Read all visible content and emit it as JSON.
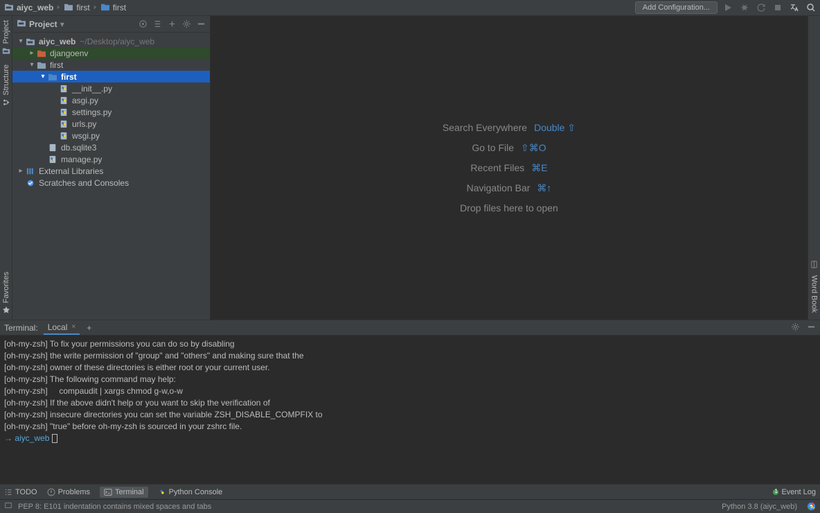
{
  "nav": {
    "crumbs": [
      "aiyc_web",
      "first",
      "first"
    ],
    "add_config": "Add Configuration..."
  },
  "leftstrip": {
    "project": "Project",
    "structure": "Structure",
    "favorites": "Favorites"
  },
  "rightstrip": {
    "wordbook": "Word Book"
  },
  "project_panel": {
    "title": "Project"
  },
  "tree": {
    "root_name": "aiyc_web",
    "root_path": "~/Desktop/aiyc_web",
    "djangoenv": "djangoenv",
    "first_outer": "first",
    "first_inner": "first",
    "init": "__init__.py",
    "asgi": "asgi.py",
    "settings": "settings.py",
    "urls": "urls.py",
    "wsgi": "wsgi.py",
    "db": "db.sqlite3",
    "manage": "manage.py",
    "extlib": "External Libraries",
    "scratches": "Scratches and Consoles"
  },
  "welcome": {
    "search": "Search Everywhere",
    "search_sc": "Double ⇧",
    "goto": "Go to File",
    "goto_sc": "⇧⌘O",
    "recent": "Recent Files",
    "recent_sc": "⌘E",
    "navbar": "Navigation Bar",
    "navbar_sc": "⌘↑",
    "drop": "Drop files here to open"
  },
  "terminal": {
    "head_label": "Terminal:",
    "tab_name": "Local",
    "lines": [
      "[oh-my-zsh] To fix your permissions you can do so by disabling",
      "[oh-my-zsh] the write permission of \"group\" and \"others\" and making sure that the",
      "[oh-my-zsh] owner of these directories is either root or your current user.",
      "[oh-my-zsh] The following command may help:",
      "[oh-my-zsh]     compaudit | xargs chmod g-w,o-w",
      "",
      "[oh-my-zsh] If the above didn't help or you want to skip the verification of",
      "[oh-my-zsh] insecure directories you can set the variable ZSH_DISABLE_COMPFIX to",
      "[oh-my-zsh] \"true\" before oh-my-zsh is sourced in your zshrc file."
    ],
    "prompt_arrow": "→ ",
    "prompt_dir": "aiyc_web"
  },
  "bottom": {
    "todo": "TODO",
    "problems": "Problems",
    "terminal": "Terminal",
    "pyconsole": "Python Console",
    "eventlog": "Event Log"
  },
  "status": {
    "pep": "PEP 8: E101 indentation contains mixed spaces and tabs",
    "pylabel": "Python 3.8 (aiyc_web)"
  },
  "colors": {
    "accent": "#1d5fbf",
    "link": "#4a88c7",
    "djangoenv": "#c75f3e"
  }
}
